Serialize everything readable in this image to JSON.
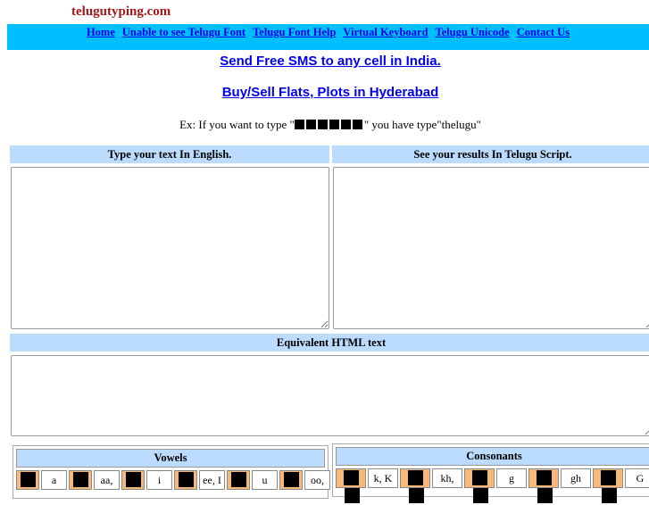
{
  "site_title": "telugutyping.com",
  "nav": [
    {
      "label": "Home"
    },
    {
      "label": "Unable to see Telugu Font"
    },
    {
      "label": "Telugu Font Help"
    },
    {
      "label": "Virtual Keyboard"
    },
    {
      "label": "Telugu Unicode"
    },
    {
      "label": "Contact Us"
    }
  ],
  "promos": {
    "sms": "Send Free SMS to any cell in India.",
    "flats": "Buy/Sell Flats, Plots in Hyderabad"
  },
  "example": {
    "prefix": "Ex: If you want to type \"",
    "suffix": "\" you have type\"thelugu\""
  },
  "headers": {
    "english": "Type your text In English.",
    "telugu": "See your results In Telugu Script.",
    "html": "Equivalent HTML text"
  },
  "vowels": {
    "title": "Vowels",
    "keys": [
      "a",
      "aa,",
      "i",
      "ee, I",
      "u",
      "oo,"
    ]
  },
  "consonants": {
    "title": "Consonants",
    "keys": [
      "k, K",
      "kh,",
      "g",
      "gh",
      "G"
    ]
  },
  "colors": {
    "nav_bg": "#00bfff",
    "header_bg": "#bcdcff",
    "key_bg": "#f8b878",
    "title": "#a01818"
  }
}
